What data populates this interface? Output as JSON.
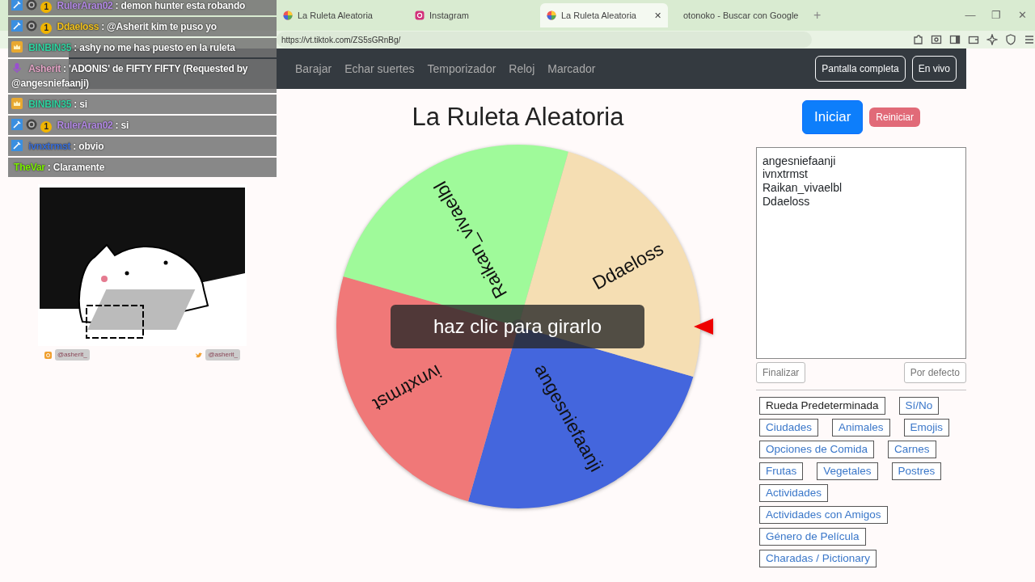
{
  "browser": {
    "tabs": [
      {
        "title": "La Ruleta Aleatoria",
        "kind": "wheel",
        "selected": false
      },
      {
        "title": "Instagram",
        "kind": "camera",
        "selected": false
      },
      {
        "title": "La Ruleta Aleatoria",
        "kind": "wheel",
        "selected": true
      },
      {
        "title": "otonoko - Buscar con Google",
        "kind": "google",
        "selected": false
      }
    ],
    "tab_close": "✕",
    "new_tab": "+",
    "window_controls": [
      "—",
      "❐",
      "✕"
    ],
    "url": "https://vt.tiktok.com/ZS5sGRnBg/"
  },
  "navbar": {
    "items": [
      "Barajar",
      "Echar suertes",
      "Temporizador",
      "Reloj",
      "Marcador"
    ],
    "buttons": [
      "Pantalla completa",
      "En vivo"
    ]
  },
  "title": "La Ruleta Aleatoria",
  "wheel": {
    "prompt": "haz clic para girarlo",
    "segments": [
      {
        "label": "angesniefaanji",
        "color": "#4466dd"
      },
      {
        "label": "ivnxtrmst",
        "color": "#f07878"
      },
      {
        "label": "Raikan_vivaelbl",
        "color": "#9ffa9a"
      },
      {
        "label": "Ddaeloss",
        "color": "#f5deb3"
      }
    ]
  },
  "start_button": "Iniciar",
  "reset_button": "Reiniciar",
  "entries": "angesniefaanji\nivnxtrmst\nRaikan_vivaelbl\nDdaeloss",
  "finish_button": "Finalizar",
  "default_button": "Por defecto",
  "presets": [
    {
      "label": "Rueda Predeterminada",
      "selected": true
    },
    {
      "label": "Sí/No",
      "selected": false
    },
    {
      "label": "Ciudades",
      "selected": false
    },
    {
      "label": "Animales",
      "selected": false
    },
    {
      "label": "Emojis",
      "selected": false
    },
    {
      "label": "Opciones de Comida",
      "selected": false
    },
    {
      "label": "Carnes",
      "selected": false
    },
    {
      "label": "Frutas",
      "selected": false
    },
    {
      "label": "Vegetales",
      "selected": false
    },
    {
      "label": "Postres",
      "selected": false
    },
    {
      "label": "Actividades",
      "selected": false
    },
    {
      "label": "Actividades con Amigos",
      "selected": false
    },
    {
      "label": "Género de Película",
      "selected": false
    },
    {
      "label": "Charadas / Pictionary",
      "selected": false
    }
  ],
  "chat": [
    {
      "user": "RulerAran02",
      "color": "#b48ae6",
      "badges": [
        {
          "kind": "moderator"
        },
        {
          "kind": "gear"
        },
        {
          "kind": "coin",
          "label": "1"
        }
      ],
      "text": "demon hunter esta robando"
    },
    {
      "user": "Ddaeloss",
      "color": "#f2c21c",
      "badges": [
        {
          "kind": "moderator"
        },
        {
          "kind": "gear"
        },
        {
          "kind": "coin",
          "label": "1"
        }
      ],
      "text": "@Asherit kim te puso yo"
    },
    {
      "user": "BINBIN35",
      "color": "#2fd3a0",
      "badges": [
        {
          "kind": "crown"
        }
      ],
      "text": "ashy no me has puesto en la ruleta"
    },
    {
      "user": "Asherit",
      "color": "#e6a6c8",
      "badges": [
        {
          "kind": "mic"
        }
      ],
      "text": "'ADONIS' de FIFTY FIFTY (Requested by @angesniefaanji)"
    },
    {
      "user": "BINBIN35",
      "color": "#2fd3a0",
      "badges": [
        {
          "kind": "crown"
        }
      ],
      "text": "si"
    },
    {
      "user": "RulerAran02",
      "color": "#b48ae6",
      "badges": [
        {
          "kind": "moderator"
        },
        {
          "kind": "gear"
        },
        {
          "kind": "coin",
          "label": "1"
        }
      ],
      "text": "si"
    },
    {
      "user": "ivnxtrmst",
      "color": "#3a6fd8",
      "badges": [
        {
          "kind": "moderator"
        }
      ],
      "text": "obvio"
    },
    {
      "user": "TheVar",
      "color": "#7cf000",
      "text": "Claramente"
    }
  ],
  "chat_separator": ":",
  "socials": [
    {
      "kind": "instagram",
      "handle": "@asherit_"
    },
    {
      "kind": "twitter",
      "handle": "@asherit_"
    }
  ]
}
